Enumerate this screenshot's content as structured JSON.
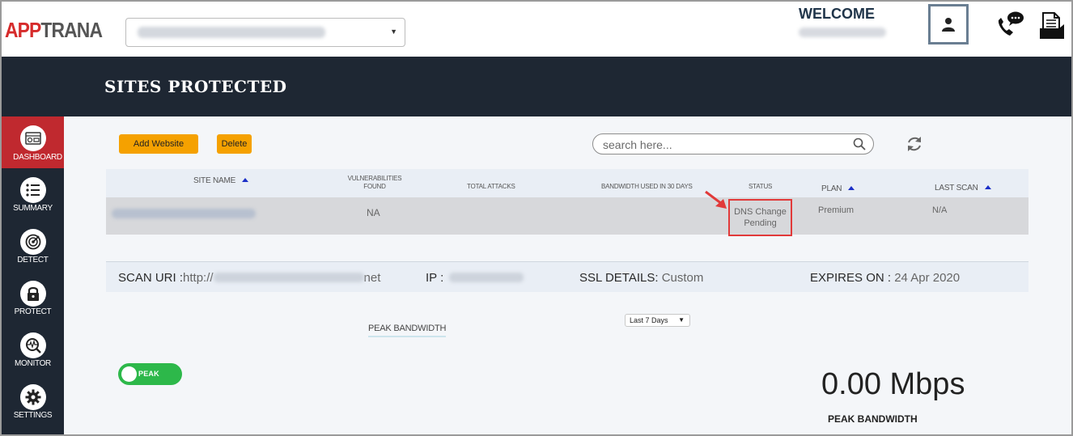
{
  "app": {
    "logo_brand": "APP",
    "logo_rest": "TRANA"
  },
  "header": {
    "site_selector": {
      "value": ""
    },
    "welcome_label": "WELCOME",
    "welcome_user": "",
    "icons": [
      "user-icon",
      "support-chat-icon",
      "documents-icon"
    ]
  },
  "page": {
    "title": "SITES PROTECTED"
  },
  "sidebar": {
    "items": [
      {
        "label": "DASHBOARD",
        "icon": "dashboard-icon",
        "active": true
      },
      {
        "label": "SUMMARY",
        "icon": "list-icon",
        "active": false
      },
      {
        "label": "DETECT",
        "icon": "radar-icon",
        "active": false
      },
      {
        "label": "PROTECT",
        "icon": "lock-icon",
        "active": false
      },
      {
        "label": "MONITOR",
        "icon": "monitor-search-icon",
        "active": false
      },
      {
        "label": "SETTINGS",
        "icon": "gear-icon",
        "active": false
      }
    ]
  },
  "toolbar": {
    "add_label": "Add Website",
    "delete_label": "Delete",
    "search_placeholder": "search here..."
  },
  "table": {
    "headers": {
      "site_name": "SITE NAME",
      "vulnerabilities_line1": "VULNERABILITIES",
      "vulnerabilities_line2": "FOUND",
      "total_attacks": "TOTAL ATTACKS",
      "bandwidth": "BANDWIDTH USED IN 30 DAYS",
      "status": "STATUS",
      "plan": "PLAN",
      "last_scan": "LAST SCAN"
    },
    "rows": [
      {
        "site_name": "",
        "vulnerabilities": "NA",
        "total_attacks": "",
        "bandwidth": "",
        "status_line1": "DNS Change",
        "status_line2": "Pending",
        "plan": "Premium",
        "last_scan": "N/A"
      }
    ]
  },
  "scan": {
    "uri_label": "SCAN URI :",
    "uri_prefix": "http://",
    "uri_suffix": "net",
    "ip_label": "IP :",
    "ssl_label": "SSL DETAILS:",
    "ssl_value": "Custom",
    "expires_label": "EXPIRES ON :",
    "expires_value": "24 Apr 2020"
  },
  "bandwidth": {
    "tab_label": "PEAK BANDWIDTH",
    "range_selected": "Last 7 Days",
    "toggle_label": "PEAK",
    "toggle_on": true,
    "value": "0.00 Mbps",
    "value_label": "PEAK BANDWIDTH"
  },
  "colors": {
    "accent": "#f5a100",
    "nav_dark": "#1e2733",
    "active_red": "#c0292f",
    "toggle_green": "#2db84a",
    "highlight_red": "#e13a3a"
  }
}
